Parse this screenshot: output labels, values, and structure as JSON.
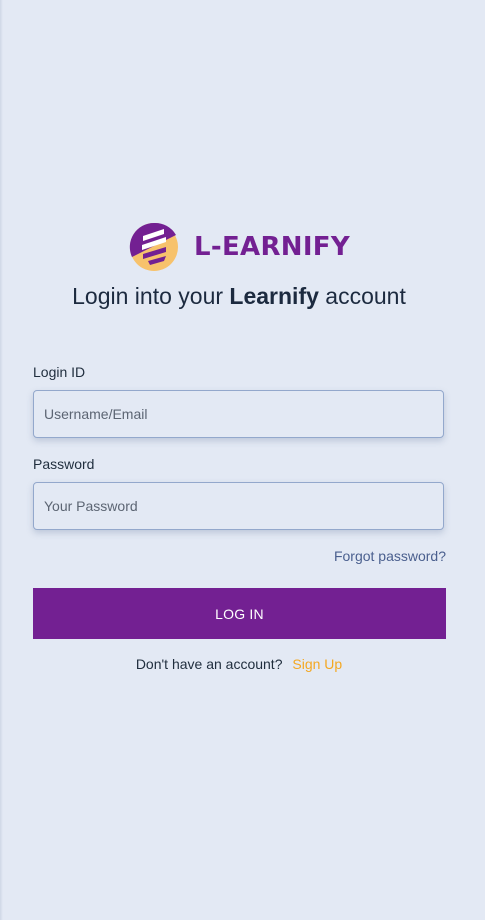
{
  "brand": {
    "name": "L-EARNIFY",
    "colors": {
      "primary": "#732092",
      "accent": "#f7c26c"
    },
    "logo_icon": "learnify-logo-icon"
  },
  "headline": {
    "prefix": "Login into your ",
    "emphasis": "Learnify",
    "suffix": " account"
  },
  "form": {
    "login_id": {
      "label": "Login ID",
      "placeholder": "Username/Email",
      "value": ""
    },
    "password": {
      "label": "Password",
      "placeholder": "Your Password",
      "value": ""
    },
    "forgot_link": "Forgot password?",
    "submit_label": "LOG IN",
    "submit_color": "#732092"
  },
  "signup": {
    "prompt": "Don't have an account?",
    "link": "Sign Up",
    "link_color": "#f4a823"
  }
}
